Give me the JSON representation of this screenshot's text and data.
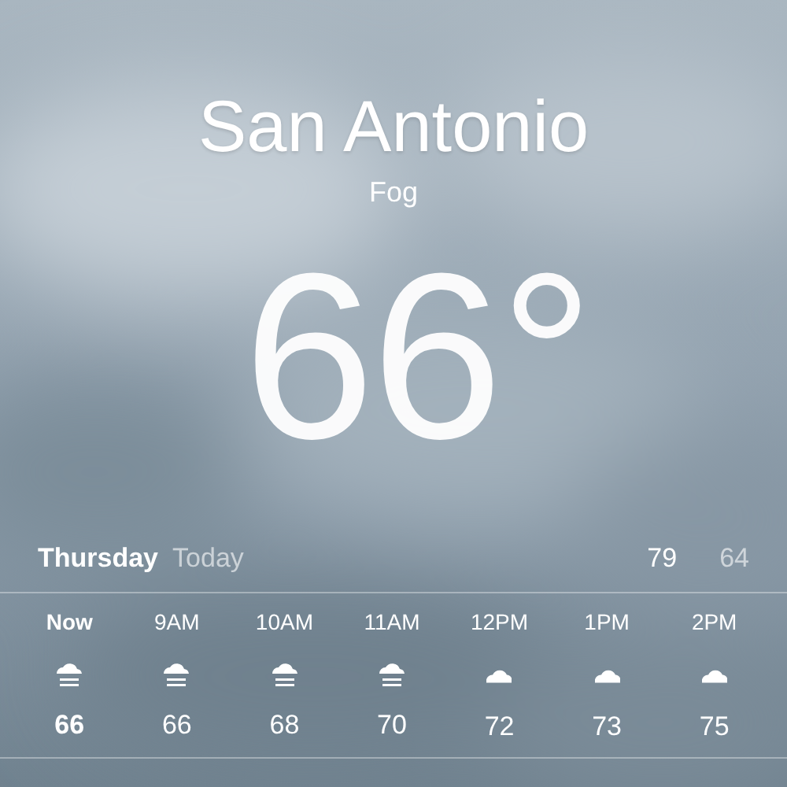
{
  "location": {
    "city": "San Antonio",
    "condition": "Fog",
    "temperature": "66°"
  },
  "day": {
    "name": "Thursday",
    "label": "Today",
    "high": "79",
    "low": "64"
  },
  "hourly": [
    {
      "time": "Now",
      "kind": "fog",
      "temp": "66",
      "selected": true
    },
    {
      "time": "9AM",
      "kind": "fog",
      "temp": "66",
      "selected": false
    },
    {
      "time": "10AM",
      "kind": "fog",
      "temp": "68",
      "selected": false
    },
    {
      "time": "11AM",
      "kind": "fog",
      "temp": "70",
      "selected": false
    },
    {
      "time": "12PM",
      "kind": "cloud",
      "temp": "72",
      "selected": false
    },
    {
      "time": "1PM",
      "kind": "cloud",
      "temp": "73",
      "selected": false
    },
    {
      "time": "2PM",
      "kind": "cloud",
      "temp": "75",
      "selected": false
    }
  ]
}
